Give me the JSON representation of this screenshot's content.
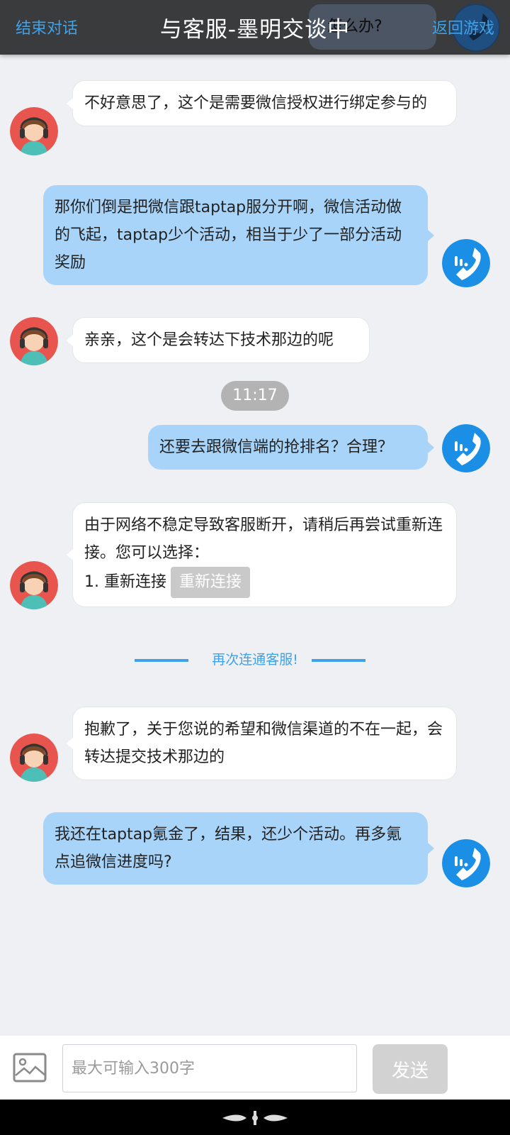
{
  "header": {
    "end_label": "结束对话",
    "title": "与客服-墨明交谈中",
    "back_label": "返回游戏",
    "ghost_text": "怎么办?"
  },
  "messages": [
    {
      "from": "agent",
      "text": "不好意思了，这个是需要微信授权进行绑定参与的"
    },
    {
      "from": "user",
      "text": "那你们倒是把微信跟taptap服分开啊，微信活动做的飞起，taptap少个活动，相当于少了一部分活动奖励"
    },
    {
      "from": "agent",
      "text": "亲亲，这个是会转达下技术那边的呢"
    },
    {
      "from": "user",
      "text": "还要去跟微信端的抢排名？合理？"
    },
    {
      "from": "agent",
      "text": "由于网络不稳定导致客服断开，请稍后再尝试重新连接。您可以选择：",
      "option_prefix": "1. 重新连接",
      "option_button": "重新连接"
    },
    {
      "from": "agent",
      "text": "抱歉了，关于您说的希望和微信渠道的不在一起，会转达提交技术那边的"
    },
    {
      "from": "user",
      "text": "我还在taptap氪金了，结果，还少个活动。再多氪点追微信进度吗?"
    }
  ],
  "timestamp": "11:17",
  "reconnect_divider": "再次连通客服!",
  "input": {
    "placeholder": "最大可输入300字",
    "send_label": "发送"
  },
  "icons": {
    "agent_avatar": "customer-service-headset-avatar",
    "user_avatar": "phone-call-avatar",
    "image_picker": "image-icon",
    "nav_handle": "navigation-handle-icon"
  },
  "colors": {
    "header_bg": "#3a3b3d",
    "accent": "#3fa1e8",
    "user_bubble": "#a8d4fa",
    "agent_bubble": "#ffffff",
    "page_bg": "#eef0f3"
  }
}
